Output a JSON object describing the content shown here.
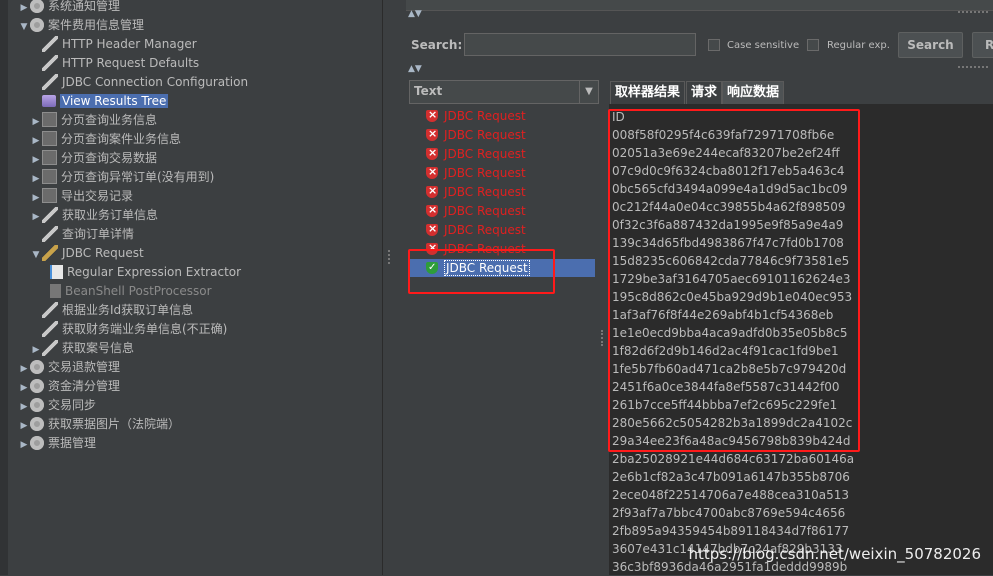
{
  "tree": {
    "items": [
      {
        "label": "系统通知管理",
        "indent": 1,
        "arrow": "▶",
        "icon": "gear",
        "name": "tree-item-system-notice"
      },
      {
        "label": "案件费用信息管理",
        "indent": 1,
        "arrow": "▼",
        "icon": "gear",
        "name": "tree-item-case-fee"
      },
      {
        "label": "HTTP Header Manager",
        "indent": 2,
        "arrow": "",
        "icon": "tool",
        "name": "tree-item-http-header-manager"
      },
      {
        "label": "HTTP Request Defaults",
        "indent": 2,
        "arrow": "",
        "icon": "tool",
        "name": "tree-item-http-request-defaults"
      },
      {
        "label": "JDBC Connection Configuration",
        "indent": 2,
        "arrow": "",
        "icon": "tool",
        "name": "tree-item-jdbc-connection-config"
      },
      {
        "label": "View Results Tree",
        "indent": 2,
        "arrow": "",
        "icon": "graph",
        "name": "tree-item-view-results-tree",
        "selected": true
      },
      {
        "label": "分页查询业务信息",
        "indent": 2,
        "arrow": "▶",
        "icon": "box",
        "name": "tree-item-page-query-business"
      },
      {
        "label": "分页查询案件业务信息",
        "indent": 2,
        "arrow": "▶",
        "icon": "box",
        "name": "tree-item-page-query-case-business"
      },
      {
        "label": "分页查询交易数据",
        "indent": 2,
        "arrow": "▶",
        "icon": "box",
        "name": "tree-item-page-query-trade"
      },
      {
        "label": "分页查询异常订单(没有用到)",
        "indent": 2,
        "arrow": "▶",
        "icon": "box",
        "name": "tree-item-page-query-abnormal"
      },
      {
        "label": "导出交易记录",
        "indent": 2,
        "arrow": "▶",
        "icon": "box",
        "name": "tree-item-export-trade"
      },
      {
        "label": "获取业务订单信息",
        "indent": 2,
        "arrow": "▶",
        "icon": "tool",
        "name": "tree-item-get-business-order"
      },
      {
        "label": "查询订单详情",
        "indent": 2,
        "arrow": "",
        "icon": "tool",
        "name": "tree-item-query-order-detail"
      },
      {
        "label": "JDBC Request",
        "indent": 2,
        "arrow": "▼",
        "icon": "tool2",
        "name": "tree-item-jdbc-request"
      },
      {
        "label": "Regular Expression Extractor",
        "indent": 3,
        "arrow": "",
        "icon": "doc",
        "name": "tree-item-regex-extractor"
      },
      {
        "label": "BeanShell PostProcessor",
        "indent": 3,
        "arrow": "",
        "icon": "doc2",
        "name": "tree-item-beanshell-postprocessor",
        "dim": true
      },
      {
        "label": "根据业务Id获取订单信息",
        "indent": 2,
        "arrow": "",
        "icon": "tool",
        "name": "tree-item-get-order-by-id"
      },
      {
        "label": "获取财务端业务单信息(不正确)",
        "indent": 2,
        "arrow": "",
        "icon": "tool",
        "name": "tree-item-get-finance-order"
      },
      {
        "label": "获取案号信息",
        "indent": 2,
        "arrow": "▶",
        "icon": "tool",
        "name": "tree-item-get-case-number"
      },
      {
        "label": "交易退款管理",
        "indent": 1,
        "arrow": "▶",
        "icon": "gear",
        "name": "tree-item-refund-mgmt"
      },
      {
        "label": "资金清分管理",
        "indent": 1,
        "arrow": "▶",
        "icon": "gear",
        "name": "tree-item-fund-clearing"
      },
      {
        "label": "交易同步",
        "indent": 1,
        "arrow": "▶",
        "icon": "gear",
        "name": "tree-item-trade-sync"
      },
      {
        "label": "获取票据图片（法院端）",
        "indent": 1,
        "arrow": "▶",
        "icon": "gear",
        "name": "tree-item-get-bill-image"
      },
      {
        "label": "票据管理",
        "indent": 1,
        "arrow": "▶",
        "icon": "gear",
        "name": "tree-item-bill-mgmt"
      }
    ]
  },
  "search": {
    "label": "Search:",
    "value": "",
    "case_sensitive": "Case sensitive",
    "regex": "Regular exp.",
    "search_button": "Search",
    "reset_button": "R"
  },
  "renderer": {
    "selected": "Text"
  },
  "results": {
    "items": [
      {
        "label": "JDBC Request",
        "status": "error"
      },
      {
        "label": "JDBC Request",
        "status": "error"
      },
      {
        "label": "JDBC Request",
        "status": "error"
      },
      {
        "label": "JDBC Request",
        "status": "error"
      },
      {
        "label": "JDBC Request",
        "status": "error"
      },
      {
        "label": "JDBC Request",
        "status": "error"
      },
      {
        "label": "JDBC Request",
        "status": "error"
      },
      {
        "label": "JDBC Request",
        "status": "error"
      },
      {
        "label": "JDBC Request",
        "status": "success",
        "selected": true
      }
    ]
  },
  "tabs": [
    {
      "label": "取样器结果",
      "active": false
    },
    {
      "label": "请求",
      "active": false
    },
    {
      "label": "响应数据",
      "active": true
    }
  ],
  "response": {
    "lines": [
      "ID",
      "008f58f0295f4c639faf72971708fb6e",
      "02051a3e69e244ecaf83207be2ef24ff",
      "07c9d0c9f6324cba8012f17eb5a463c4",
      "0bc565cfd3494a099e4a1d9d5ac1bc09",
      "0c212f44a0e04cc39855b4a62f898509",
      "0f32c3f6a887432da1995e9f85a9e4a9",
      "139c34d65fbd4983867f47c7fd0b1708",
      "15d8235c606842cda77846c9f73581e5",
      "1729be3af3164705aec69101162624e3",
      "195c8d862c0e45ba929d9b1e040ec953",
      "1af3af76f8f44e269abf4b1cf54368eb",
      "1e1e0ecd9bba4aca9adfd0b35e05b8c5",
      "1f82d6f2d9b146d2ac4f91cac1fd9be1",
      "1fe5b7fb60ad471ca2b8e5b7c979420d",
      "2451f6a0ce3844fa8ef5587c31442f00",
      "261b7cce5ff44bbba7ef2c695c229fe1",
      "280e5662c5054282b3a1899dc2a4102c",
      "29a34ee23f6a48ac9456798b839b424d",
      "2ba25028921e44d684c63172ba60146a",
      "2e6b1cf82a3c47b091a6147b355b8706",
      "2ece048f22514706a7e488cea310a513",
      "2f93af7a7bbc4700abc8769e594c4656",
      "2fb895a94359454b89118434d7f86177",
      "3607e431c14147bdb7c24af829b3133",
      "36c3bf8936da46a2951fa1deddd9989b"
    ]
  },
  "watermark": "https://blog.csdn.net/weixin_50782026"
}
